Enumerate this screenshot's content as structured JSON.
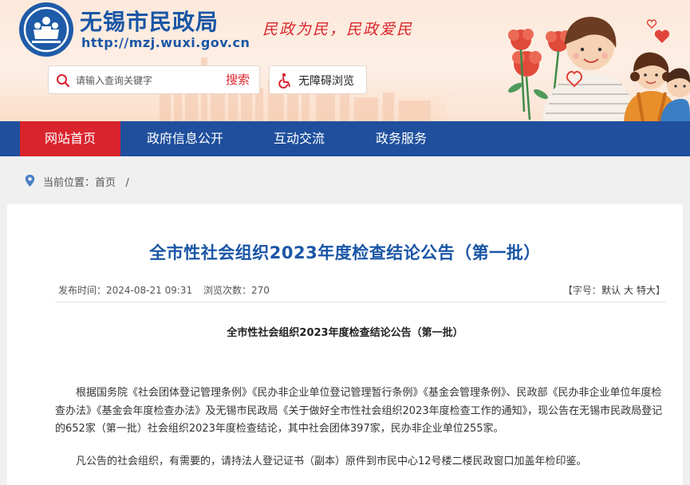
{
  "header": {
    "site_name": "无锡市民政局",
    "site_url": "http://mzj.wuxi.gov.cn",
    "slogan": "民政为民，民政爱民",
    "search": {
      "placeholder": "请输入查询关键字",
      "button_label": "搜索"
    },
    "accessibility_label": "无障碍浏览",
    "colors": {
      "brand_blue": "#1a56a6",
      "accent_red": "#d9232d"
    }
  },
  "nav": {
    "items": [
      {
        "label": "网站首页",
        "active": true
      },
      {
        "label": "政府信息公开",
        "active": false
      },
      {
        "label": "互动交流",
        "active": false
      },
      {
        "label": "政务服务",
        "active": false
      }
    ]
  },
  "breadcrumb": {
    "prefix": "当前位置：",
    "home": "首页",
    "separator": "/"
  },
  "article": {
    "title": "全市性社会组织2023年度检查结论公告（第一批）",
    "publish_label": "发布时间：",
    "publish_time": "2024-08-21 09:31",
    "views_label": "浏览次数：",
    "views": "270",
    "font_size": {
      "prefix": "【字号：",
      "default": "默认",
      "large": "大",
      "xlarge": "特大",
      "suffix": "】"
    },
    "subtitle": "全市性社会组织2023年度检查结论公告（第一批）",
    "paragraphs": [
      "根据国务院《社会团体登记管理条例》《民办非企业单位登记管理暂行条例》《基金会管理条例》、民政部《民办非企业单位年度检查办法》《基金会年度检查办法》及无锡市民政局《关于做好全市性社会组织2023年度检查工作的通知》，现公告在无锡市民政局登记的652家（第一批）社会组织2023年度检查结论，其中社会团体397家，民办非企业单位255家。",
      "凡公告的社会组织，有需要的，请持法人登记证书（副本）原件到市民中心12号楼二楼民政窗口加盖年检印鉴。"
    ]
  }
}
